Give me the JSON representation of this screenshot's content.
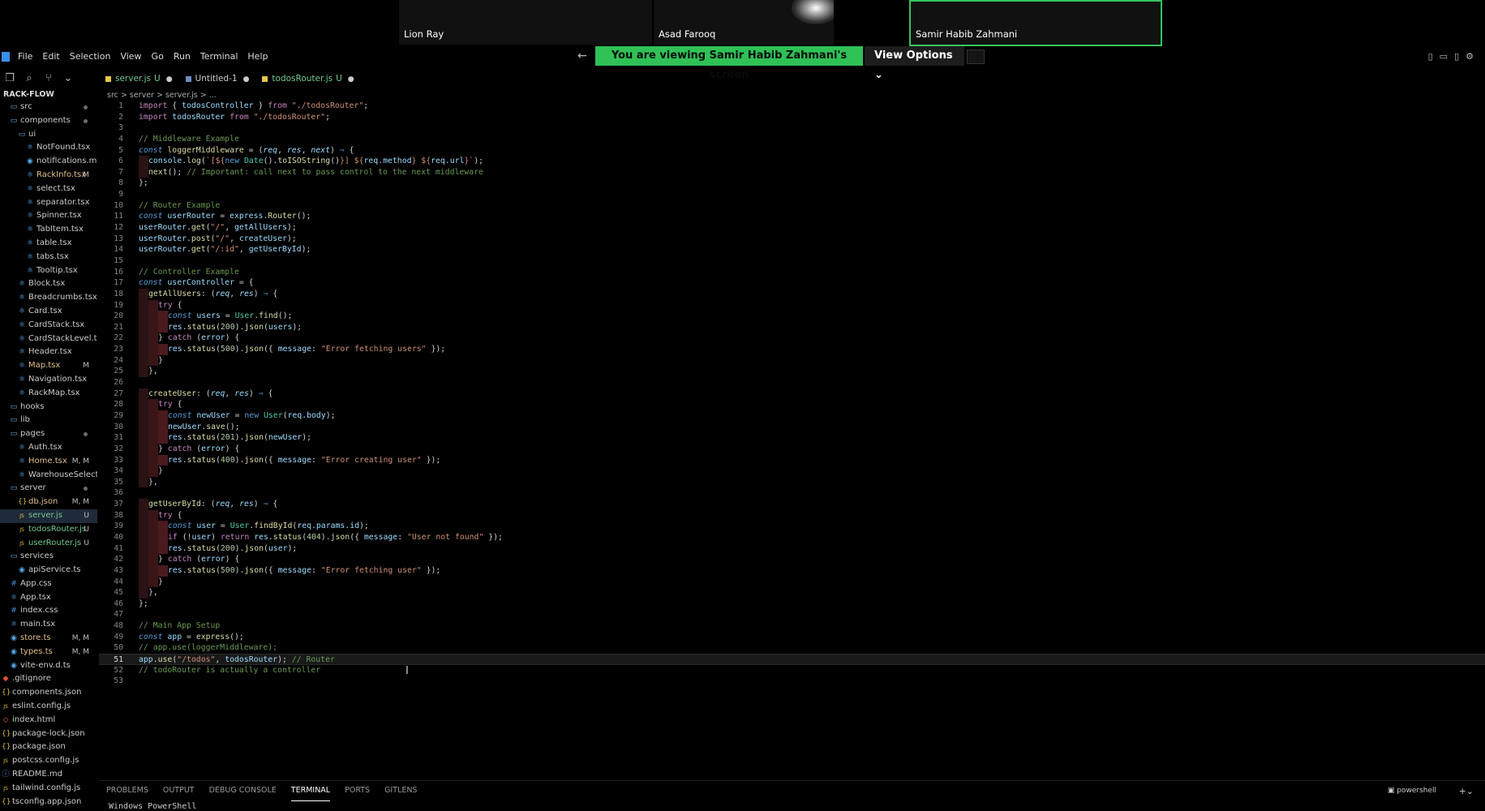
{
  "participants": [
    {
      "name": "Lion Ray"
    },
    {
      "name": "Asad Farooq"
    },
    {
      "name": "Samir Habib Zahmani"
    }
  ],
  "share_banner": "You are viewing  Samir Habib Zahmani's screen",
  "view_options": "View Options ⌄",
  "menu": [
    "File",
    "Edit",
    "Selection",
    "View",
    "Go",
    "Run",
    "Terminal",
    "Help"
  ],
  "explorer": {
    "project": "RACK-FLOW",
    "tree": [
      {
        "label": "src",
        "icon": "folder-icon",
        "depth": 0,
        "kind": "folder",
        "dot": true
      },
      {
        "label": "components",
        "icon": "folder-icon",
        "depth": 0,
        "kind": "folder",
        "dot": true
      },
      {
        "label": "ui",
        "icon": "folder-icon",
        "depth": 1,
        "kind": "folder"
      },
      {
        "label": "NotFound.tsx",
        "icon": "tsx-file-icon",
        "depth": 2,
        "kind": "tsx"
      },
      {
        "label": "notifications.mod...",
        "icon": "ts-file-icon",
        "depth": 2,
        "kind": "ts"
      },
      {
        "label": "RackInfo.tsx",
        "icon": "tsx-file-icon",
        "depth": 2,
        "kind": "tsx",
        "badge": "M"
      },
      {
        "label": "select.tsx",
        "icon": "tsx-file-icon",
        "depth": 2,
        "kind": "tsx"
      },
      {
        "label": "separator.tsx",
        "icon": "tsx-file-icon",
        "depth": 2,
        "kind": "tsx"
      },
      {
        "label": "Spinner.tsx",
        "icon": "tsx-file-icon",
        "depth": 2,
        "kind": "tsx"
      },
      {
        "label": "TabItem.tsx",
        "icon": "tsx-file-icon",
        "depth": 2,
        "kind": "tsx"
      },
      {
        "label": "table.tsx",
        "icon": "tsx-file-icon",
        "depth": 2,
        "kind": "tsx"
      },
      {
        "label": "tabs.tsx",
        "icon": "tsx-file-icon",
        "depth": 2,
        "kind": "tsx"
      },
      {
        "label": "Tooltip.tsx",
        "icon": "tsx-file-icon",
        "depth": 2,
        "kind": "tsx"
      },
      {
        "label": "Block.tsx",
        "icon": "tsx-file-icon",
        "depth": 1,
        "kind": "tsx"
      },
      {
        "label": "Breadcrumbs.tsx",
        "icon": "tsx-file-icon",
        "depth": 1,
        "kind": "tsx"
      },
      {
        "label": "Card.tsx",
        "icon": "tsx-file-icon",
        "depth": 1,
        "kind": "tsx"
      },
      {
        "label": "CardStack.tsx",
        "icon": "tsx-file-icon",
        "depth": 1,
        "kind": "tsx"
      },
      {
        "label": "CardStackLevel.tsx",
        "icon": "tsx-file-icon",
        "depth": 1,
        "kind": "tsx"
      },
      {
        "label": "Header.tsx",
        "icon": "tsx-file-icon",
        "depth": 1,
        "kind": "tsx"
      },
      {
        "label": "Map.tsx",
        "icon": "tsx-file-icon",
        "depth": 1,
        "kind": "tsx",
        "badge": "M"
      },
      {
        "label": "Navigation.tsx",
        "icon": "tsx-file-icon",
        "depth": 1,
        "kind": "tsx"
      },
      {
        "label": "RackMap.tsx",
        "icon": "tsx-file-icon",
        "depth": 1,
        "kind": "tsx"
      },
      {
        "label": "hooks",
        "icon": "folder-icon",
        "depth": 0,
        "kind": "folder"
      },
      {
        "label": "lib",
        "icon": "folder-icon",
        "depth": 0,
        "kind": "folder"
      },
      {
        "label": "pages",
        "icon": "folder-icon",
        "depth": 0,
        "kind": "folder",
        "dot": true
      },
      {
        "label": "Auth.tsx",
        "icon": "tsx-file-icon",
        "depth": 1,
        "kind": "tsx"
      },
      {
        "label": "Home.tsx",
        "icon": "tsx-file-icon",
        "depth": 1,
        "kind": "tsx",
        "badge": "M, M"
      },
      {
        "label": "WarehouseSelectio...",
        "icon": "tsx-file-icon",
        "depth": 1,
        "kind": "tsx"
      },
      {
        "label": "server",
        "icon": "folder-icon",
        "depth": 0,
        "kind": "folder",
        "dot": true
      },
      {
        "label": "db.json",
        "icon": "json-file-icon",
        "depth": 1,
        "kind": "json",
        "badge": "M, M"
      },
      {
        "label": "server.js",
        "icon": "js-file-icon",
        "depth": 1,
        "kind": "js",
        "badge": "U",
        "selected": true
      },
      {
        "label": "todosRouter.js",
        "icon": "js-file-icon",
        "depth": 1,
        "kind": "js",
        "badge": "U"
      },
      {
        "label": "userRouter.js",
        "icon": "js-file-icon",
        "depth": 1,
        "kind": "js",
        "badge": "U"
      },
      {
        "label": "services",
        "icon": "folder-icon",
        "depth": 0,
        "kind": "folder"
      },
      {
        "label": "apiService.ts",
        "icon": "ts-file-icon",
        "depth": 1,
        "kind": "ts"
      },
      {
        "label": "App.css",
        "icon": "css-file-icon",
        "depth": 0,
        "kind": "css"
      },
      {
        "label": "App.tsx",
        "icon": "tsx-file-icon",
        "depth": 0,
        "kind": "tsx"
      },
      {
        "label": "index.css",
        "icon": "css-file-icon",
        "depth": 0,
        "kind": "css"
      },
      {
        "label": "main.tsx",
        "icon": "tsx-file-icon",
        "depth": 0,
        "kind": "tsx"
      },
      {
        "label": "store.ts",
        "icon": "ts-file-icon",
        "depth": 0,
        "kind": "ts",
        "badge": "M, M"
      },
      {
        "label": "types.ts",
        "icon": "ts-file-icon",
        "depth": 0,
        "kind": "ts",
        "badge": "M, M"
      },
      {
        "label": "vite-env.d.ts",
        "icon": "ts-file-icon",
        "depth": 0,
        "kind": "ts"
      },
      {
        "label": ".gitignore",
        "icon": "git-icon",
        "depth": -1,
        "kind": "git"
      },
      {
        "label": "components.json",
        "icon": "json-braces-icon",
        "depth": -1,
        "kind": "json"
      },
      {
        "label": "eslint.config.js",
        "icon": "js-file-icon",
        "depth": -1,
        "kind": "js"
      },
      {
        "label": "index.html",
        "icon": "html-file-icon",
        "depth": -1,
        "kind": "html"
      },
      {
        "label": "package-lock.json",
        "icon": "json-file-icon",
        "depth": -1,
        "kind": "json"
      },
      {
        "label": "package.json",
        "icon": "json-file-icon",
        "depth": -1,
        "kind": "json"
      },
      {
        "label": "postcss.config.js",
        "icon": "js-file-icon",
        "depth": -1,
        "kind": "js"
      },
      {
        "label": "README.md",
        "icon": "info-icon",
        "depth": -1,
        "kind": "md"
      },
      {
        "label": "tailwind.config.js",
        "icon": "js-file-icon",
        "depth": -1,
        "kind": "js"
      },
      {
        "label": "tsconfig.app.json",
        "icon": "json-braces-icon",
        "depth": -1,
        "kind": "json"
      }
    ]
  },
  "tabs": [
    {
      "label": "server.js",
      "status": "U",
      "active": true,
      "kind": "js"
    },
    {
      "label": "Untitled-1",
      "status": "",
      "active": false,
      "kind": "txt"
    },
    {
      "label": "todosRouter.js",
      "status": "U",
      "active": false,
      "kind": "js"
    }
  ],
  "breadcrumb": "src  >  server  >  server.js  >  ...",
  "code": {
    "current_line": 51,
    "lines": [
      {
        "n": 1,
        "ind": 0,
        "html": "<span style='color:#c586c0'>import</span> { <span style='color:#9cdcfe'>todosController</span> } <span style='color:#c586c0'>from</span> <span style='color:#ce9178'>\"./todosRouter\"</span>;"
      },
      {
        "n": 2,
        "ind": 0,
        "html": "<span style='color:#c586c0'>import</span> <span style='color:#9cdcfe'>todosRouter</span> <span style='color:#c586c0'>from</span> <span style='color:#ce9178'>\"./todosRouter\"</span>;"
      },
      {
        "n": 3,
        "ind": 0,
        "html": ""
      },
      {
        "n": 4,
        "ind": 0,
        "html": "<span style='color:#6a9955'>// Middleware Example</span>"
      },
      {
        "n": 5,
        "ind": 0,
        "html": "<span style='color:#569cd6;font-style:italic'>const</span> <span style='color:#dcdcaa'>loggerMiddleware</span> = (<span style='color:#9cdcfe;font-style:italic'>req</span>, <span style='color:#9cdcfe;font-style:italic'>res</span>, <span style='color:#9cdcfe;font-style:italic'>next</span>) <span style='color:#569cd6'>⇒</span> {"
      },
      {
        "n": 6,
        "ind": 1,
        "html": "<span style='color:#9cdcfe'>console</span>.<span style='color:#dcdcaa'>log</span>(<span style='color:#ce9178'>`[${</span><span style='color:#569cd6'>new</span> <span style='color:#4ec9b0'>Date</span>().<span style='color:#dcdcaa'>toISOString</span>()<span style='color:#ce9178'>}] ${</span><span style='color:#9cdcfe'>req</span>.<span style='color:#9cdcfe'>method</span><span style='color:#ce9178'>} ${</span><span style='color:#9cdcfe'>req</span>.<span style='color:#9cdcfe'>url</span><span style='color:#ce9178'>}`</span>);"
      },
      {
        "n": 7,
        "ind": 1,
        "html": "<span style='color:#dcdcaa'>next</span>(); <span style='color:#6a9955'>// Important: call next to pass control to the next middleware</span>"
      },
      {
        "n": 8,
        "ind": 0,
        "html": "};"
      },
      {
        "n": 9,
        "ind": 0,
        "html": ""
      },
      {
        "n": 10,
        "ind": 0,
        "html": "<span style='color:#6a9955'>// Router Example</span>"
      },
      {
        "n": 11,
        "ind": 0,
        "html": "<span style='color:#569cd6;font-style:italic'>const</span> <span style='color:#9cdcfe'>userRouter</span> = <span style='color:#9cdcfe'>express</span>.<span style='color:#dcdcaa'>Router</span>();"
      },
      {
        "n": 12,
        "ind": 0,
        "html": "<span style='color:#9cdcfe'>userRouter</span>.<span style='color:#dcdcaa'>get</span>(<span style='color:#ce9178'>\"/\"</span>, <span style='color:#9cdcfe'>getAllUsers</span>);"
      },
      {
        "n": 13,
        "ind": 0,
        "html": "<span style='color:#9cdcfe'>userRouter</span>.<span style='color:#dcdcaa'>post</span>(<span style='color:#ce9178'>\"/\"</span>, <span style='color:#9cdcfe'>createUser</span>);"
      },
      {
        "n": 14,
        "ind": 0,
        "html": "<span style='color:#9cdcfe'>userRouter</span>.<span style='color:#dcdcaa'>get</span>(<span style='color:#ce9178'>\"/:id\"</span>, <span style='color:#9cdcfe'>getUserById</span>);"
      },
      {
        "n": 15,
        "ind": 0,
        "html": ""
      },
      {
        "n": 16,
        "ind": 0,
        "html": "<span style='color:#6a9955'>// Controller Example</span>"
      },
      {
        "n": 17,
        "ind": 0,
        "html": "<span style='color:#569cd6;font-style:italic'>const</span> <span style='color:#9cdcfe'>userController</span> = {"
      },
      {
        "n": 18,
        "ind": 1,
        "html": "<span style='color:#dcdcaa'>getAllUsers</span>: (<span style='color:#9cdcfe;font-style:italic'>req</span>, <span style='color:#9cdcfe;font-style:italic'>res</span>) <span style='color:#569cd6'>⇒</span> {"
      },
      {
        "n": 19,
        "ind": 2,
        "html": "<span style='color:#c586c0'>try</span> {"
      },
      {
        "n": 20,
        "ind": 3,
        "html": "<span style='color:#569cd6;font-style:italic'>const</span> <span style='color:#9cdcfe'>users</span> = <span style='color:#4ec9b0'>User</span>.<span style='color:#dcdcaa'>find</span>();"
      },
      {
        "n": 21,
        "ind": 3,
        "html": "<span style='color:#9cdcfe'>res</span>.<span style='color:#dcdcaa'>status</span>(<span style='color:#b5cea8'>200</span>).<span style='color:#dcdcaa'>json</span>(<span style='color:#9cdcfe'>users</span>);"
      },
      {
        "n": 22,
        "ind": 2,
        "html": "} <span style='color:#c586c0'>catch</span> (<span style='color:#9cdcfe'>error</span>) {"
      },
      {
        "n": 23,
        "ind": 3,
        "html": "<span style='color:#9cdcfe'>res</span>.<span style='color:#dcdcaa'>status</span>(<span style='color:#b5cea8'>500</span>).<span style='color:#dcdcaa'>json</span>({ <span style='color:#9cdcfe'>message</span>: <span style='color:#ce9178'>\"Error fetching users\"</span> });"
      },
      {
        "n": 24,
        "ind": 2,
        "html": "}"
      },
      {
        "n": 25,
        "ind": 1,
        "html": "},"
      },
      {
        "n": 26,
        "ind": 0,
        "html": ""
      },
      {
        "n": 27,
        "ind": 1,
        "html": "<span style='color:#dcdcaa'>createUser</span>: (<span style='color:#9cdcfe;font-style:italic'>req</span>, <span style='color:#9cdcfe;font-style:italic'>res</span>) <span style='color:#569cd6'>⇒</span> {"
      },
      {
        "n": 28,
        "ind": 2,
        "html": "<span style='color:#c586c0'>try</span> {"
      },
      {
        "n": 29,
        "ind": 3,
        "html": "<span style='color:#569cd6;font-style:italic'>const</span> <span style='color:#9cdcfe'>newUser</span> = <span style='color:#569cd6'>new</span> <span style='color:#4ec9b0'>User</span>(<span style='color:#9cdcfe'>req</span>.<span style='color:#9cdcfe'>body</span>);"
      },
      {
        "n": 30,
        "ind": 3,
        "html": "<span style='color:#9cdcfe'>newUser</span>.<span style='color:#dcdcaa'>save</span>();"
      },
      {
        "n": 31,
        "ind": 3,
        "html": "<span style='color:#9cdcfe'>res</span>.<span style='color:#dcdcaa'>status</span>(<span style='color:#b5cea8'>201</span>).<span style='color:#dcdcaa'>json</span>(<span style='color:#9cdcfe'>newUser</span>);"
      },
      {
        "n": 32,
        "ind": 2,
        "html": "} <span style='color:#c586c0'>catch</span> (<span style='color:#9cdcfe'>error</span>) {"
      },
      {
        "n": 33,
        "ind": 3,
        "html": "<span style='color:#9cdcfe'>res</span>.<span style='color:#dcdcaa'>status</span>(<span style='color:#b5cea8'>400</span>).<span style='color:#dcdcaa'>json</span>({ <span style='color:#9cdcfe'>message</span>: <span style='color:#ce9178'>\"Error creating user\"</span> });"
      },
      {
        "n": 34,
        "ind": 2,
        "html": "}"
      },
      {
        "n": 35,
        "ind": 1,
        "html": "},"
      },
      {
        "n": 36,
        "ind": 0,
        "html": ""
      },
      {
        "n": 37,
        "ind": 1,
        "html": "<span style='color:#dcdcaa'>getUserById</span>: (<span style='color:#9cdcfe;font-style:italic'>req</span>, <span style='color:#9cdcfe;font-style:italic'>res</span>) <span style='color:#569cd6'>⇒</span> {"
      },
      {
        "n": 38,
        "ind": 2,
        "html": "<span style='color:#c586c0'>try</span> {"
      },
      {
        "n": 39,
        "ind": 3,
        "html": "<span style='color:#569cd6;font-style:italic'>const</span> <span style='color:#9cdcfe'>user</span> = <span style='color:#4ec9b0'>User</span>.<span style='color:#dcdcaa'>findById</span>(<span style='color:#9cdcfe'>req</span>.<span style='color:#9cdcfe'>params</span>.<span style='color:#9cdcfe'>id</span>);"
      },
      {
        "n": 40,
        "ind": 3,
        "html": "<span style='color:#c586c0'>if</span> (!<span style='color:#9cdcfe'>user</span>) <span style='color:#c586c0'>return</span> <span style='color:#9cdcfe'>res</span>.<span style='color:#dcdcaa'>status</span>(<span style='color:#b5cea8'>404</span>).<span style='color:#dcdcaa'>json</span>({ <span style='color:#9cdcfe'>message</span>: <span style='color:#ce9178'>\"User not found\"</span> });"
      },
      {
        "n": 41,
        "ind": 3,
        "html": "<span style='color:#9cdcfe'>res</span>.<span style='color:#dcdcaa'>status</span>(<span style='color:#b5cea8'>200</span>).<span style='color:#dcdcaa'>json</span>(<span style='color:#9cdcfe'>user</span>);"
      },
      {
        "n": 42,
        "ind": 2,
        "html": "} <span style='color:#c586c0'>catch</span> (<span style='color:#9cdcfe'>error</span>) {"
      },
      {
        "n": 43,
        "ind": 3,
        "html": "<span style='color:#9cdcfe'>res</span>.<span style='color:#dcdcaa'>status</span>(<span style='color:#b5cea8'>500</span>).<span style='color:#dcdcaa'>json</span>({ <span style='color:#9cdcfe'>message</span>: <span style='color:#ce9178'>\"Error fetching user\"</span> });"
      },
      {
        "n": 44,
        "ind": 2,
        "html": "}"
      },
      {
        "n": 45,
        "ind": 1,
        "html": "},"
      },
      {
        "n": 46,
        "ind": 0,
        "html": "};"
      },
      {
        "n": 47,
        "ind": 0,
        "html": ""
      },
      {
        "n": 48,
        "ind": 0,
        "html": "<span style='color:#6a9955'>// Main App Setup</span>"
      },
      {
        "n": 49,
        "ind": 0,
        "html": "<span style='color:#569cd6;font-style:italic'>const</span> <span style='color:#9cdcfe'>app</span> = <span style='color:#dcdcaa'>express</span>();"
      },
      {
        "n": 50,
        "ind": 0,
        "html": "<span style='color:#6a9955'>// app.use(loggerMiddleware);</span>"
      },
      {
        "n": 51,
        "ind": 0,
        "html": "<span style='color:#9cdcfe'>app</span>.<span style='color:#dcdcaa'>use</span>(<span style='color:#ce9178'>\"/todos\"</span>, <span style='color:#9cdcfe'>todosRouter</span>); <span style='color:#6a9955'>// Router</span>"
      },
      {
        "n": 52,
        "ind": 0,
        "html": "<span style='color:#6a9955'>// todoRouter is actually a controller</span>"
      },
      {
        "n": 53,
        "ind": 0,
        "html": ""
      }
    ]
  },
  "panel": {
    "tabs": [
      "PROBLEMS",
      "OUTPUT",
      "DEBUG CONSOLE",
      "TERMINAL",
      "PORTS",
      "GITLENS"
    ],
    "active_tab": "TERMINAL",
    "terminal_name": "powershell",
    "terminal_text": "Windows PowerShell"
  }
}
